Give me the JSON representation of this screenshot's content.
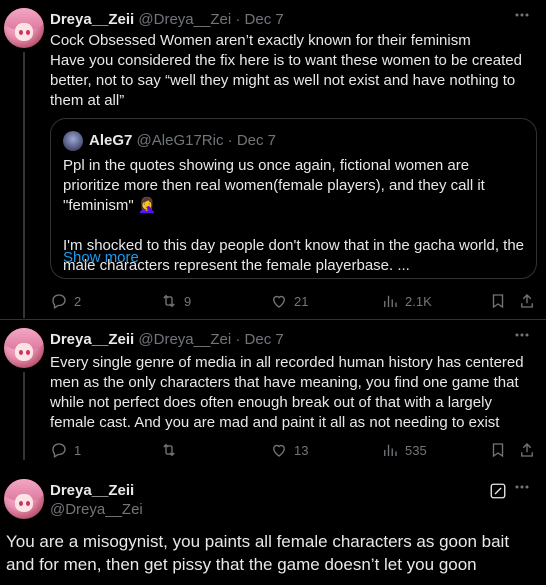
{
  "posts": [
    {
      "name": "Dreya__Zeii",
      "handle": "@Dreya__Zei",
      "sep": "·",
      "date": "Dec 7",
      "text": "Cock Obsessed Women aren’t exactly known for their feminism\nHave you considered the fix here is to want these women to be created better, not to say “well they might as well not exist and have nothing to them at all”",
      "quote": {
        "name": "AleG7",
        "handle": "@AleG17Ric",
        "sep": "·",
        "date": "Dec 7",
        "text": "Ppl in the quotes showing us once again, fictional women are prioritize more then real women(female players), and they call it \"feminism\" 🤦‍♀️\n\nI'm shocked to this day people don't know that in the gacha world, the male characters represent the female playerbase. ...",
        "show_more": "Show more"
      },
      "stats": {
        "replies": "2",
        "reposts": "9",
        "likes": "21",
        "views": "2.1K"
      }
    },
    {
      "name": "Dreya__Zeii",
      "handle": "@Dreya__Zei",
      "sep": "·",
      "date": "Dec 7",
      "text": "Every single genre of media in all recorded human history has centered men as the only characters that have meaning, you find one game that while not perfect does often enough break out of that with a largely female cast. And you are mad and paint it all as not needing to exist",
      "stats": {
        "replies": "1",
        "reposts": "",
        "likes": "13",
        "views": "535"
      }
    }
  ],
  "main_post": {
    "name": "Dreya__Zeii",
    "handle": "@Dreya__Zei",
    "text": "You are a misogynist, you paints all female characters as goon bait and for men, then get pissy that the game doesn’t let you goon"
  },
  "icons": {
    "reply": "reply-icon",
    "repost": "repost-icon",
    "like": "like-icon",
    "views": "views-icon",
    "bookmark": "bookmark-icon",
    "share": "share-icon",
    "more": "more-icon",
    "edit": "edit-icon"
  },
  "colors": {
    "background": "#000000",
    "text": "#e7e9ea",
    "muted": "#71767b",
    "link": "#1d9bf0",
    "border": "#2f3336"
  }
}
